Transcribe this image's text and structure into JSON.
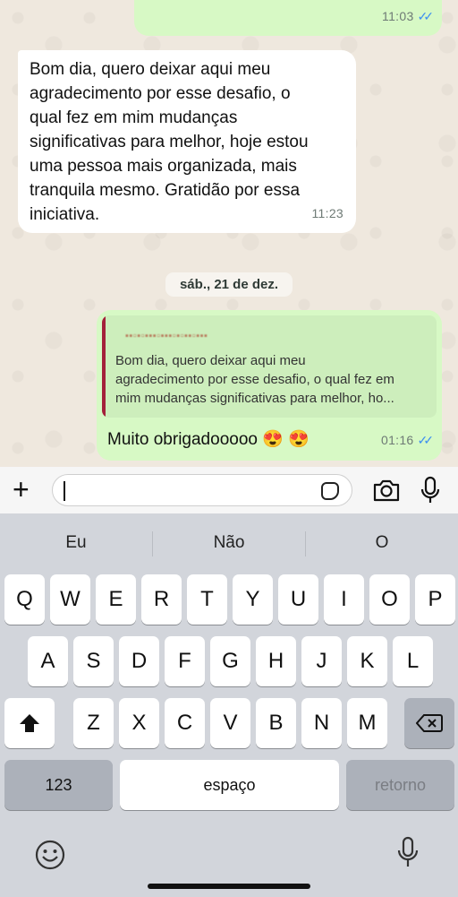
{
  "chat": {
    "top_message": {
      "time": "11:03"
    },
    "incoming": {
      "text_lines": [
        "Bom dia, quero deixar aqui meu",
        "agradecimento por esse desafio, o",
        "qual fez em mim mudanças",
        "significativas para melhor, hoje estou",
        "uma pessoa mais organizada, mais",
        "tranquila mesmo. Gratidão por essa",
        "iniciativa."
      ],
      "time": "11:23"
    },
    "date_chip": "sáb., 21 de dez.",
    "outgoing": {
      "quote_lines": [
        "Bom dia, quero deixar aqui meu",
        "agradecimento por esse desafio, o qual fez em",
        "mim mudanças significativas para melhor, ho..."
      ],
      "reply": "Muito obrigadooooo 😍 😍",
      "time": "01:16"
    }
  },
  "input": {
    "placeholder": ""
  },
  "keyboard": {
    "suggestions": [
      "Eu",
      "Não",
      "O"
    ],
    "row1": [
      "Q",
      "W",
      "E",
      "R",
      "T",
      "Y",
      "U",
      "I",
      "O",
      "P"
    ],
    "row2": [
      "A",
      "S",
      "D",
      "F",
      "G",
      "H",
      "J",
      "K",
      "L"
    ],
    "row3": [
      "Z",
      "X",
      "C",
      "V",
      "B",
      "N",
      "M"
    ],
    "numbers_label": "123",
    "space_label": "espaço",
    "return_label": "retorno"
  },
  "colors": {
    "outgoing_bubble": "#d7f9c5",
    "incoming_bubble": "#ffffff",
    "read_ticks": "#3d8ff0",
    "quote_bar": "#a3203a"
  }
}
